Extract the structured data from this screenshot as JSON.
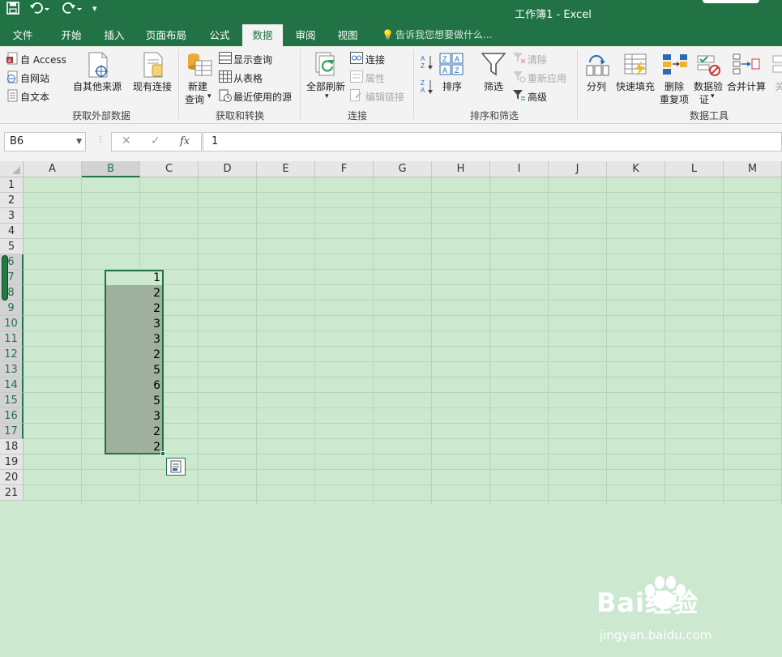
{
  "titlebar": {
    "title": "工作簿1 - Excel",
    "save_icon": "save-icon",
    "undo_icon": "undo-icon",
    "redo_icon": "redo-icon"
  },
  "tabs": [
    {
      "label": "文件"
    },
    {
      "label": "开始"
    },
    {
      "label": "插入"
    },
    {
      "label": "页面布局"
    },
    {
      "label": "公式"
    },
    {
      "label": "数据",
      "active": true
    },
    {
      "label": "审阅"
    },
    {
      "label": "视图"
    }
  ],
  "tell_me": "告诉我您想要做什么...",
  "ribbon": {
    "external": {
      "access": "自 Access",
      "web": "自网站",
      "text": "自文本",
      "other": "自其他来源",
      "existing": "现有连接",
      "group": "获取外部数据"
    },
    "transform": {
      "new_query_1": "新建",
      "new_query_2": "查询",
      "show_query": "显示查询",
      "from_table": "从表格",
      "recent": "最近使用的源",
      "group": "获取和转换"
    },
    "connections": {
      "refresh_all": "全部刷新",
      "connections": "连接",
      "properties": "属性",
      "edit_links": "编辑链接",
      "group": "连接"
    },
    "sort": {
      "sort": "排序",
      "filter": "筛选",
      "clear": "清除",
      "reapply": "重新应用",
      "advanced": "高级",
      "group": "排序和筛选"
    },
    "tools": {
      "split": "分列",
      "flash_fill": "快速填充",
      "remove_dup_1": "删除",
      "remove_dup_2": "重复项",
      "validation_1": "数据验",
      "validation_2": "证",
      "consolidate": "合并计算",
      "more": "关",
      "group": "数据工具"
    }
  },
  "formula_bar": {
    "name_box": "B6",
    "cancel": "✕",
    "enter": "✓",
    "fx": "fx",
    "content": "1"
  },
  "columns": [
    "A",
    "B",
    "C",
    "D",
    "E",
    "F",
    "G",
    "H",
    "I",
    "J",
    "K",
    "L",
    "M"
  ],
  "rows": [
    "1",
    "2",
    "3",
    "4",
    "5",
    "6",
    "7",
    "8",
    "9",
    "10",
    "11",
    "12",
    "13",
    "14",
    "15",
    "16",
    "17",
    "18",
    "19",
    "20",
    "21"
  ],
  "selection": {
    "range": "B6:B17",
    "values": [
      "1",
      "2",
      "2",
      "3",
      "3",
      "2",
      "5",
      "6",
      "5",
      "3",
      "2",
      "2"
    ]
  },
  "watermark": {
    "brand": "Bai经验",
    "url": "jingyan.baidu.com"
  },
  "colors": {
    "excel_green": "#217346",
    "sheet_bg": "#cce8cf",
    "selection_fill": "#9fb09f"
  }
}
